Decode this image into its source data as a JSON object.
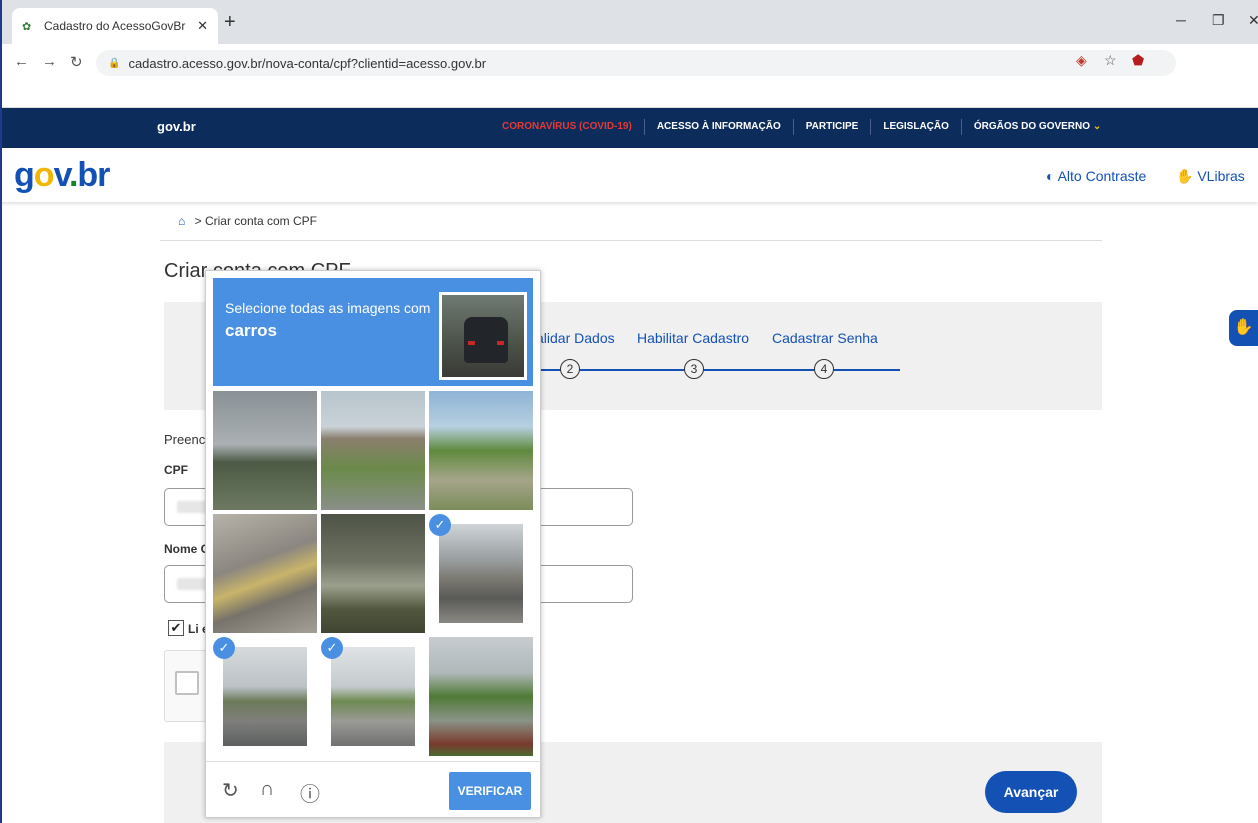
{
  "browser": {
    "tab_title": "Cadastro do AcessoGovBr",
    "url": "cadastro.acesso.gov.br/nova-conta/cpf?clientid=acesso.gov.br"
  },
  "govbar": {
    "logo": "gov.br",
    "links": [
      "CORONAVÍRUS (COVID-19)",
      "ACESSO À INFORMAÇÃO",
      "PARTICIPE",
      "LEGISLAÇÃO",
      "ÓRGÃOS DO GOVERNO"
    ]
  },
  "header": {
    "logo_parts": [
      "g",
      "o",
      "v",
      ".",
      "br"
    ],
    "high_contrast": "Alto Contraste",
    "vlibras": "VLibras"
  },
  "breadcrumb": {
    "current": "Criar conta com CPF"
  },
  "page": {
    "title": "Criar conta com CPF",
    "steps": [
      {
        "label": "Validar Dados",
        "visible_label": "alidar Dados",
        "number": "2"
      },
      {
        "label": "Habilitar Cadastro",
        "number": "3"
      },
      {
        "label": "Cadastrar Senha",
        "number": "4"
      }
    ],
    "form_intro": "Preenc",
    "cpf_label": "CPF",
    "name_label": "Nome C",
    "terms_label": "Li e",
    "next_button": "Avançar"
  },
  "captcha": {
    "instruction": "Selecione todas as imagens com",
    "object": "carros",
    "verify_button": "VERIFICAR",
    "tiles": [
      {
        "selected": false
      },
      {
        "selected": false
      },
      {
        "selected": false
      },
      {
        "selected": false
      },
      {
        "selected": false
      },
      {
        "selected": true
      },
      {
        "selected": true
      },
      {
        "selected": true
      },
      {
        "selected": false
      }
    ]
  },
  "colors": {
    "gov_blue": "#1351b4",
    "gov_navy": "#0c2c5c",
    "covid_red": "#e53935",
    "captcha_blue": "#4a90e2"
  }
}
